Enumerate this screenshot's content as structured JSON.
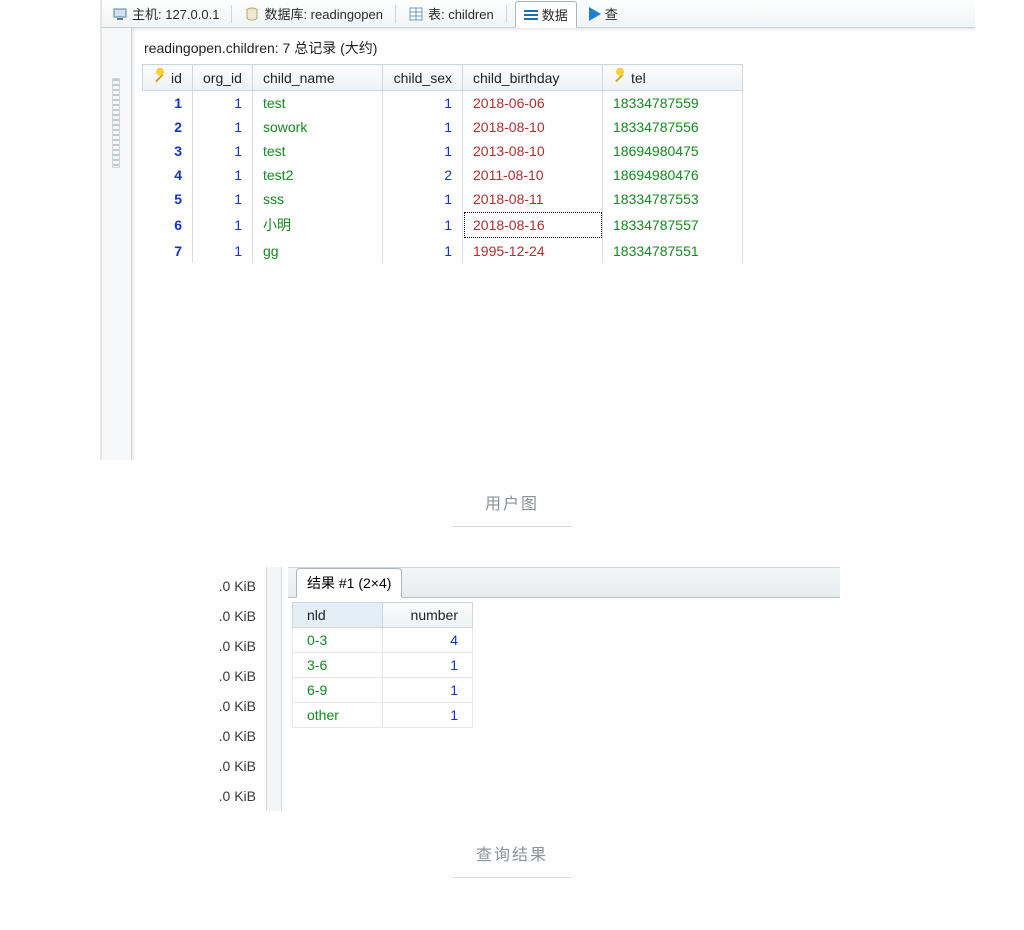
{
  "toolbar": {
    "host_label": "主机: 127.0.0.1",
    "db_label": "数据库: readingopen",
    "table_label": "表: children",
    "data_tab": "数据",
    "run_label": "查"
  },
  "summary": "readingopen.children: 7 总记录 (大约)",
  "columns": {
    "id": "id",
    "org_id": "org_id",
    "child_name": "child_name",
    "child_sex": "child_sex",
    "child_birthday": "child_birthday",
    "tel": "tel"
  },
  "rows": [
    {
      "id": "1",
      "org_id": "1",
      "child_name": "test",
      "child_sex": "1",
      "child_birthday": "2018-06-06",
      "tel": "18334787559"
    },
    {
      "id": "2",
      "org_id": "1",
      "child_name": "sowork",
      "child_sex": "1",
      "child_birthday": "2018-08-10",
      "tel": "18334787556"
    },
    {
      "id": "3",
      "org_id": "1",
      "child_name": "test",
      "child_sex": "1",
      "child_birthday": "2013-08-10",
      "tel": "18694980475"
    },
    {
      "id": "4",
      "org_id": "1",
      "child_name": "test2",
      "child_sex": "2",
      "child_birthday": "2011-08-10",
      "tel": "18694980476"
    },
    {
      "id": "5",
      "org_id": "1",
      "child_name": "sss",
      "child_sex": "1",
      "child_birthday": "2018-08-11",
      "tel": "18334787553"
    },
    {
      "id": "6",
      "org_id": "1",
      "child_name": "小明",
      "child_sex": "1",
      "child_birthday": "2018-08-16",
      "tel": "18334787557",
      "focus": true
    },
    {
      "id": "7",
      "org_id": "1",
      "child_name": "gg",
      "child_sex": "1",
      "child_birthday": "1995-12-24",
      "tel": "18334787551"
    }
  ],
  "caption1": "用户图",
  "sizes": [
    ".0 KiB",
    ".0 KiB",
    ".0 KiB",
    ".0 KiB",
    ".0 KiB",
    ".0 KiB",
    ".0 KiB",
    ".0 KiB"
  ],
  "result_tab": "结果 #1 (2×4)",
  "result_cols": {
    "nld": "nld",
    "number": "number"
  },
  "results": [
    {
      "nld": "0-3",
      "number": "4"
    },
    {
      "nld": "3-6",
      "number": "1"
    },
    {
      "nld": "6-9",
      "number": "1"
    },
    {
      "nld": "other",
      "number": "1"
    }
  ],
  "caption2": "查询结果"
}
